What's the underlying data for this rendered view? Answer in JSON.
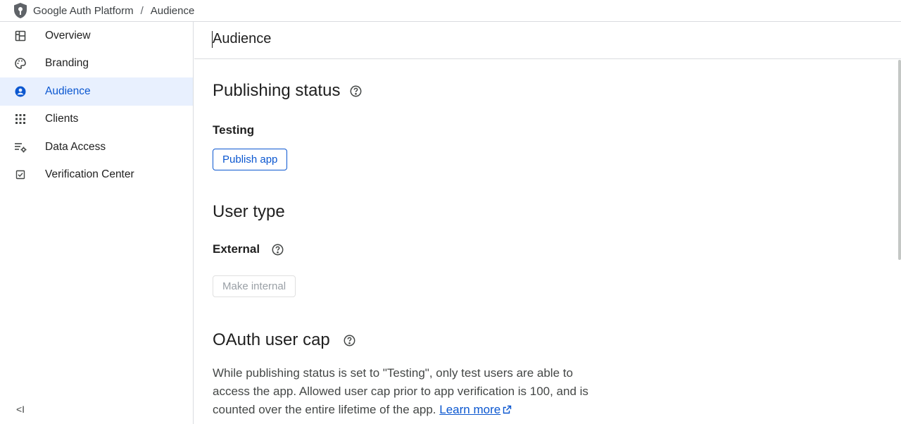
{
  "breadcrumb": {
    "app": "Google Auth Platform",
    "separator": "/",
    "page": "Audience"
  },
  "sidebar": {
    "items": [
      {
        "label": "Overview",
        "icon": "dashboard-icon"
      },
      {
        "label": "Branding",
        "icon": "palette-icon"
      },
      {
        "label": "Audience",
        "icon": "account-circle-icon",
        "active": true
      },
      {
        "label": "Clients",
        "icon": "apps-grid-icon"
      },
      {
        "label": "Data Access",
        "icon": "data-settings-icon"
      },
      {
        "label": "Verification Center",
        "icon": "verified-checkbox-icon"
      }
    ],
    "collapse_label": "<I"
  },
  "header": {
    "title": "Audience"
  },
  "publishing": {
    "heading": "Publishing status",
    "status": "Testing",
    "button": "Publish app"
  },
  "user_type": {
    "heading": "User type",
    "type": "External",
    "button": "Make internal"
  },
  "oauth_cap": {
    "heading": "OAuth user cap",
    "text": "While publishing status is set to \"Testing\", only test users are able to access the app. Allowed user cap prior to app verification is 100, and is counted over the entire lifetime of the app.",
    "link": "Learn more"
  },
  "colors": {
    "accent": "#0b57d0",
    "active_bg": "#e8f0fe",
    "border": "#dadce0"
  }
}
